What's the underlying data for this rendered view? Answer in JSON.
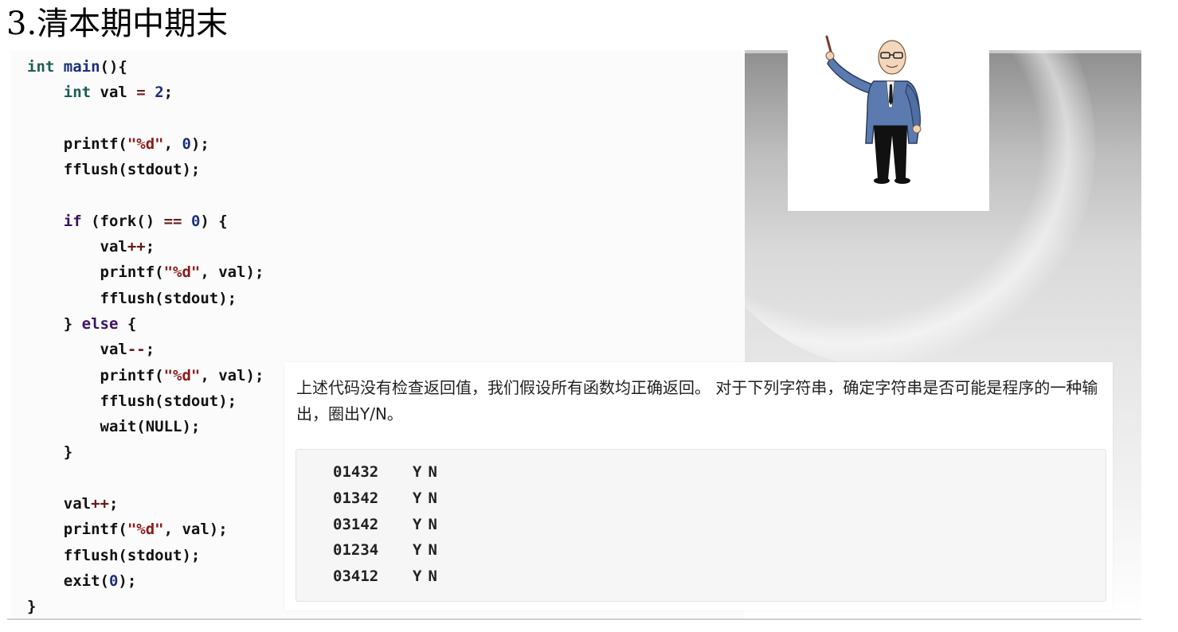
{
  "slide": {
    "title": "3.清本期中期末"
  },
  "code_lines": [
    "int main(){",
    "    int val = 2;",
    "",
    "    printf(\"%d\", 0);",
    "    fflush(stdout);",
    "",
    "    if (fork() == 0) {",
    "        val++;",
    "        printf(\"%d\", val);",
    "        fflush(stdout);",
    "    } else {",
    "        val--;",
    "        printf(\"%d\", val);",
    "        fflush(stdout);",
    "        wait(NULL);",
    "    }",
    "",
    "    val++;",
    "    printf(\"%d\", val);",
    "    fflush(stdout);",
    "    exit(0);",
    "}"
  ],
  "question": {
    "text": "上述代码没有检查返回值，我们假设所有函数均正确返回。 对于下列字符串，确定字符串是否可能是程序的一种输出，圈出Y/N。",
    "options": [
      {
        "sequence": "01432",
        "yes": "Y",
        "no": "N"
      },
      {
        "sequence": "01342",
        "yes": "Y",
        "no": "N"
      },
      {
        "sequence": "03142",
        "yes": "Y",
        "no": "N"
      },
      {
        "sequence": "01234",
        "yes": "Y",
        "no": "N"
      },
      {
        "sequence": "03412",
        "yes": "Y",
        "no": "N"
      }
    ]
  },
  "illustration": {
    "icon": "teacher-pointing-icon"
  }
}
